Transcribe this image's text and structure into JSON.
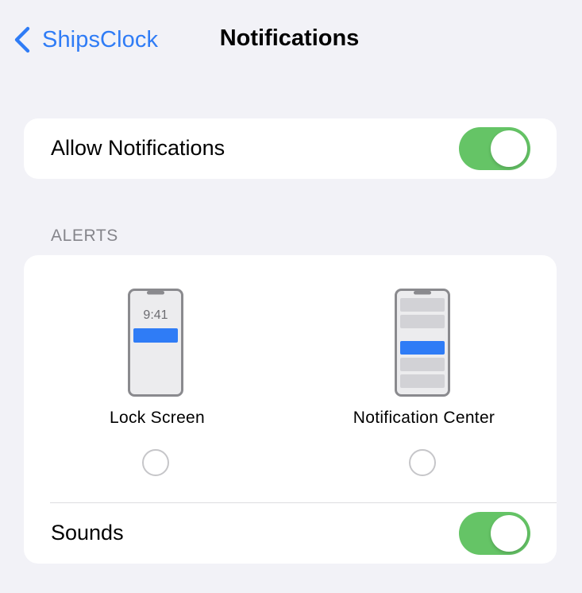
{
  "nav": {
    "back_label": "ShipsClock",
    "title": "Notifications"
  },
  "allow_notifications": {
    "label": "Allow Notifications",
    "enabled": true
  },
  "alerts": {
    "header": "ALERTS",
    "options": [
      {
        "label": "Lock Screen",
        "preview_time": "9:41",
        "selected": false
      },
      {
        "label": "Notification Center",
        "selected": false
      }
    ],
    "sounds": {
      "label": "Sounds",
      "enabled": true
    }
  },
  "colors": {
    "accent": "#2f7cf6",
    "toggle_on": "#65c466",
    "background": "#f2f2f7",
    "card": "#ffffff",
    "secondary_text": "#85858b"
  },
  "icons": [
    "back-chevron-icon",
    "lock-screen-phone-icon",
    "notification-center-phone-icon"
  ]
}
